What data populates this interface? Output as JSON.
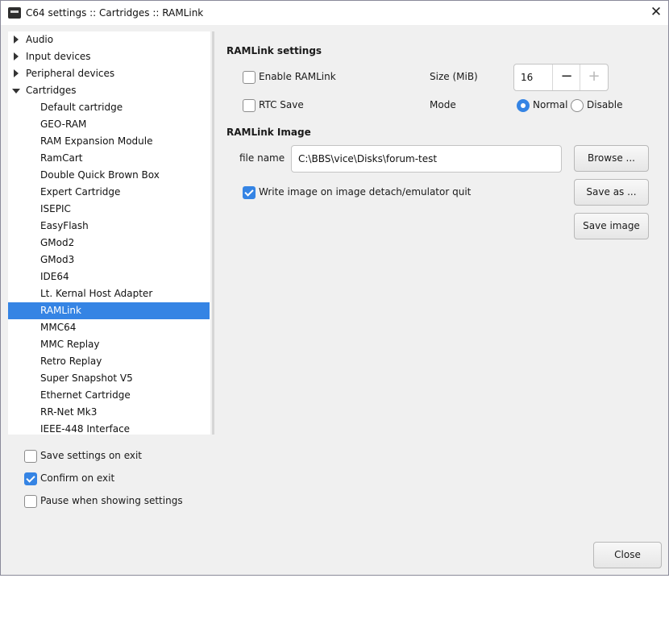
{
  "window": {
    "title": "C64 settings :: Cartridges :: RAMLink",
    "app_icon": "vice-app-icon",
    "close_glyph": "✕"
  },
  "tree": {
    "items": [
      {
        "label": "Audio",
        "level": 1,
        "expander": "collapsed"
      },
      {
        "label": "Input devices",
        "level": 1,
        "expander": "collapsed"
      },
      {
        "label": "Peripheral devices",
        "level": 1,
        "expander": "collapsed"
      },
      {
        "label": "Cartridges",
        "level": 1,
        "expander": "expanded"
      },
      {
        "label": "Default cartridge",
        "level": 2
      },
      {
        "label": "GEO-RAM",
        "level": 2
      },
      {
        "label": "RAM Expansion Module",
        "level": 2
      },
      {
        "label": "RamCart",
        "level": 2
      },
      {
        "label": "Double Quick Brown Box",
        "level": 2
      },
      {
        "label": "Expert Cartridge",
        "level": 2
      },
      {
        "label": "ISEPIC",
        "level": 2
      },
      {
        "label": "EasyFlash",
        "level": 2
      },
      {
        "label": "GMod2",
        "level": 2
      },
      {
        "label": "GMod3",
        "level": 2
      },
      {
        "label": "IDE64",
        "level": 2
      },
      {
        "label": "Lt. Kernal Host Adapter",
        "level": 2
      },
      {
        "label": "RAMLink",
        "level": 2,
        "selected": true
      },
      {
        "label": "MMC64",
        "level": 2
      },
      {
        "label": "MMC Replay",
        "level": 2
      },
      {
        "label": "Retro Replay",
        "level": 2
      },
      {
        "label": "Super Snapshot V5",
        "level": 2
      },
      {
        "label": "Ethernet Cartridge",
        "level": 2
      },
      {
        "label": "RR-Net Mk3",
        "level": 2
      },
      {
        "label": "IEEE-448 Interface",
        "level": 2
      }
    ]
  },
  "bottom_options": {
    "save_on_exit": {
      "label": "Save settings on exit",
      "checked": false
    },
    "confirm_on_exit": {
      "label": "Confirm on exit",
      "checked": true
    },
    "pause_when_showing": {
      "label": "Pause when showing settings",
      "checked": false
    }
  },
  "ramlink_settings": {
    "heading": "RAMLink settings",
    "enable": {
      "label": "Enable RAMLink",
      "checked": false
    },
    "rtc_save": {
      "label": "RTC Save",
      "checked": false
    },
    "size": {
      "label": "Size (MiB)",
      "value": "16",
      "minus": "−",
      "plus": "+"
    },
    "mode": {
      "label": "Mode",
      "options": [
        "Normal",
        "Disable"
      ],
      "selected": "Normal"
    }
  },
  "ramlink_image": {
    "heading": "RAMLink Image",
    "file_label": "file name",
    "file_value": "C:\\BBS\\vice\\Disks\\forum-test",
    "write_on_detach": {
      "label": "Write image on image detach/emulator quit",
      "checked": true
    },
    "browse_label": "Browse ...",
    "save_as_label": "Save as ...",
    "save_image_label": "Save image"
  },
  "footer": {
    "close_label": "Close"
  },
  "colors": {
    "accent": "#3584e4",
    "window_bg": "#f0f0f0",
    "tree_bg": "#ffffff"
  }
}
